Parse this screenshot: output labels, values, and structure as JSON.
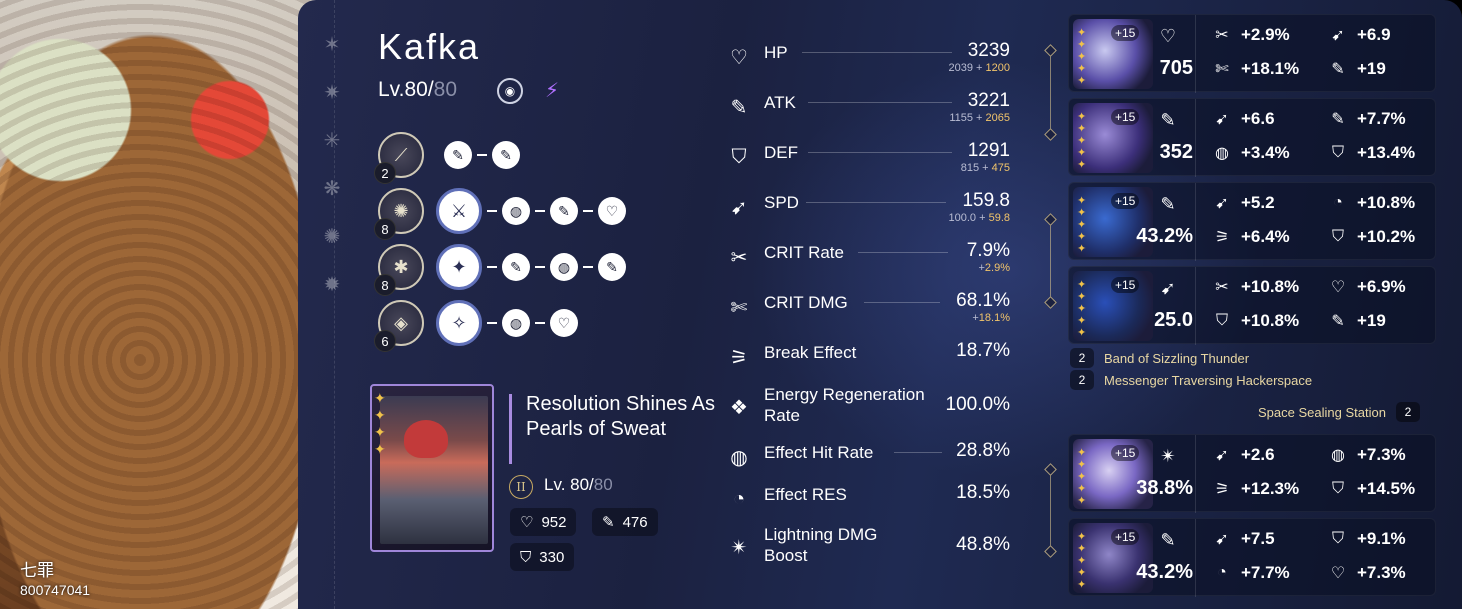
{
  "profile": {
    "signature": "七罪",
    "uid": "800747041"
  },
  "character": {
    "name": "Kafka",
    "level_label": "Lv.80/",
    "level_max": "80",
    "path_icon": "nihility-path-icon",
    "element_icon": "lightning-element-icon",
    "eidolon_icons": [
      "eidolon-1-icon",
      "eidolon-2-icon",
      "eidolon-3-icon",
      "eidolon-4-icon",
      "eidolon-5-icon",
      "eidolon-6-icon"
    ]
  },
  "traces": [
    {
      "skill_level": "2",
      "skill_icon": "basic-attack-icon",
      "major": false,
      "minors": [
        "atk-icon",
        "atk-icon"
      ]
    },
    {
      "skill_level": "8",
      "skill_icon": "skill-icon",
      "major": true,
      "minors": [
        "effect-hit-rate-icon",
        "atk-icon",
        "hp-icon"
      ]
    },
    {
      "skill_level": "8",
      "skill_icon": "ultimate-icon",
      "major": true,
      "minors": [
        "atk-icon",
        "effect-hit-rate-icon",
        "atk-icon"
      ]
    },
    {
      "skill_level": "6",
      "skill_icon": "talent-icon",
      "major": true,
      "minors": [
        "effect-hit-rate-icon",
        "hp-icon"
      ]
    }
  ],
  "light_cone": {
    "name": "Resolution Shines As Pearls of Sweat",
    "superimposition": "II",
    "level_label": "Lv. 80/",
    "level_max": "80",
    "stats": {
      "hp": "952",
      "atk": "476",
      "def": "330"
    }
  },
  "stats": [
    {
      "label": "HP",
      "value": "3239",
      "base": "2039",
      "add": "1200",
      "icon": "hp-icon"
    },
    {
      "label": "ATK",
      "value": "3221",
      "base": "1155",
      "add": "2065",
      "icon": "atk-icon"
    },
    {
      "label": "DEF",
      "value": "1291",
      "base": "815",
      "add": "475",
      "icon": "def-icon"
    },
    {
      "label": "SPD",
      "value": "159.8",
      "base": "100.0",
      "add": "59.8",
      "icon": "spd-icon"
    },
    {
      "label": "CRIT Rate",
      "value": "7.9%",
      "base": "",
      "add": "2.9%",
      "icon": "crit-rate-icon"
    },
    {
      "label": "CRIT DMG",
      "value": "68.1%",
      "base": "",
      "add": "18.1%",
      "icon": "crit-dmg-icon"
    },
    {
      "label": "Break Effect",
      "value": "18.7%",
      "icon": "break-effect-icon"
    },
    {
      "label": "Energy Regeneration Rate",
      "value": "100.0%",
      "icon": "energy-regen-icon"
    },
    {
      "label": "Effect Hit Rate",
      "value": "28.8%",
      "icon": "effect-hit-rate-icon"
    },
    {
      "label": "Effect RES",
      "value": "18.5%",
      "icon": "effect-res-icon"
    },
    {
      "label": "Lightning DMG Boost",
      "value": "48.8%",
      "icon": "lightning-dmg-icon"
    }
  ],
  "relics": [
    {
      "level": "+15",
      "main_icon": "hp-icon",
      "main_value": "705",
      "subs": [
        {
          "icon": "crit-rate-icon",
          "value": "+2.9%"
        },
        {
          "icon": "spd-icon",
          "value": "+6.9"
        },
        {
          "icon": "crit-dmg-icon",
          "value": "+18.1%"
        },
        {
          "icon": "atk-icon",
          "value": "+19"
        }
      ]
    },
    {
      "level": "+15",
      "main_icon": "atk-icon",
      "main_value": "352",
      "subs": [
        {
          "icon": "spd-icon",
          "value": "+6.6"
        },
        {
          "icon": "atk-icon",
          "value": "+7.7%"
        },
        {
          "icon": "effect-hit-rate-icon",
          "value": "+3.4%"
        },
        {
          "icon": "def-icon",
          "value": "+13.4%"
        }
      ]
    },
    {
      "level": "+15",
      "main_icon": "atk-icon",
      "main_value": "43.2%",
      "subs": [
        {
          "icon": "spd-icon",
          "value": "+5.2"
        },
        {
          "icon": "effect-res-icon",
          "value": "+10.8%"
        },
        {
          "icon": "break-effect-icon",
          "value": "+6.4%"
        },
        {
          "icon": "def-icon",
          "value": "+10.2%"
        }
      ]
    },
    {
      "level": "+15",
      "main_icon": "spd-icon",
      "main_value": "25.0",
      "subs": [
        {
          "icon": "crit-rate-icon",
          "value": "+10.8%"
        },
        {
          "icon": "hp-icon",
          "value": "+6.9%"
        },
        {
          "icon": "def-icon",
          "value": "+10.8%"
        },
        {
          "icon": "atk-icon",
          "value": "+19"
        }
      ]
    },
    {
      "level": "+15",
      "main_icon": "lightning-dmg-icon",
      "main_value": "38.8%",
      "subs": [
        {
          "icon": "spd-icon",
          "value": "+2.6"
        },
        {
          "icon": "effect-hit-rate-icon",
          "value": "+7.3%"
        },
        {
          "icon": "break-effect-icon",
          "value": "+12.3%"
        },
        {
          "icon": "def-icon",
          "value": "+14.5%"
        }
      ]
    },
    {
      "level": "+15",
      "main_icon": "atk-icon",
      "main_value": "43.2%",
      "subs": [
        {
          "icon": "spd-icon",
          "value": "+7.5"
        },
        {
          "icon": "def-icon",
          "value": "+9.1%"
        },
        {
          "icon": "effect-res-icon",
          "value": "+7.7%"
        },
        {
          "icon": "hp-icon",
          "value": "+7.3%"
        }
      ]
    }
  ],
  "relic_sets": [
    {
      "count": "2",
      "name": "Band of Sizzling Thunder"
    },
    {
      "count": "2",
      "name": "Messenger Traversing Hackerspace"
    }
  ],
  "planar_set": {
    "count": "2",
    "name": "Space Sealing Station"
  },
  "colors": {
    "accent_gold": "#f1c46b",
    "lc_border": "#9f86d9",
    "lightning": "#b070ff"
  }
}
